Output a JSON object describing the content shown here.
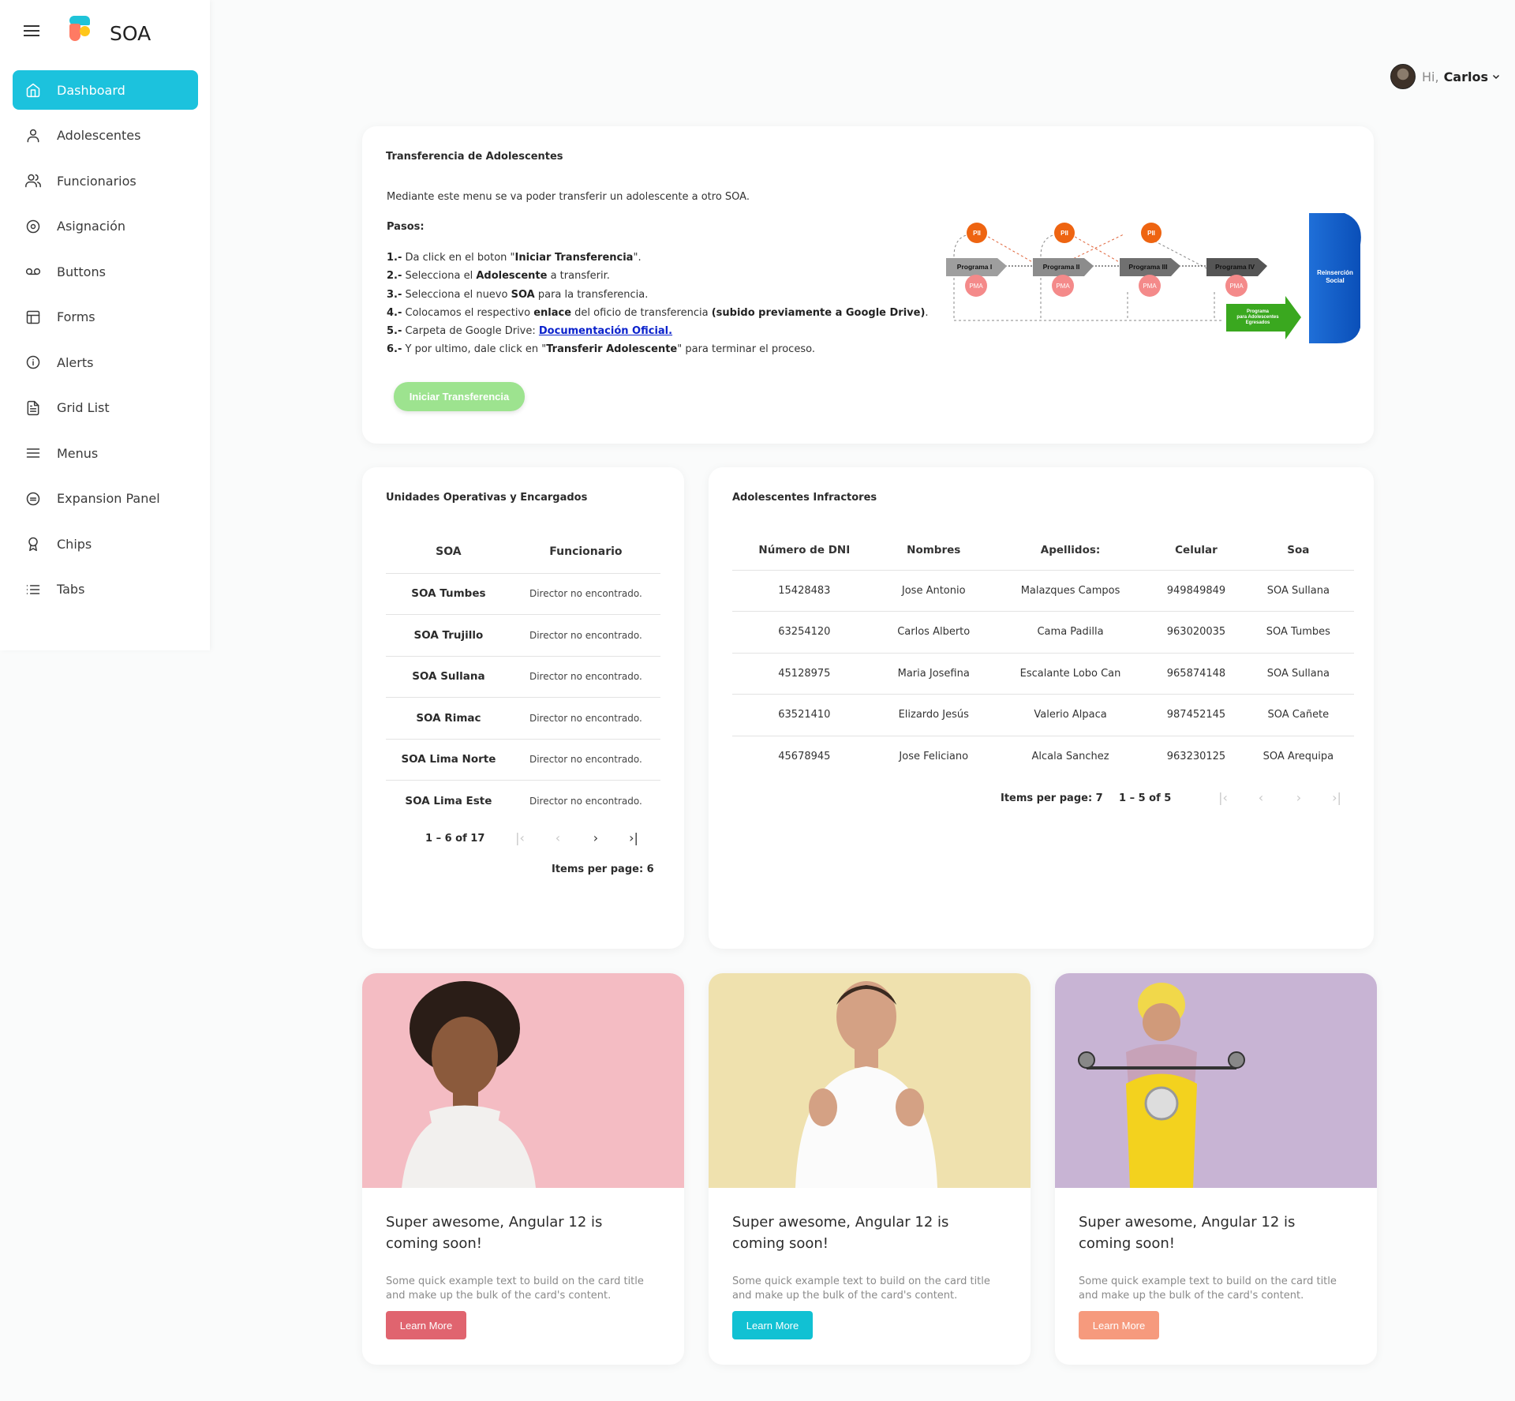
{
  "app": {
    "brand": "SOA"
  },
  "user": {
    "greeting": "Hi,",
    "name": "Carlos"
  },
  "sidebar": {
    "items": [
      {
        "label": "Dashboard",
        "icon": "home-icon",
        "active": true
      },
      {
        "label": "Adolescentes",
        "icon": "user-icon"
      },
      {
        "label": "Funcionarios",
        "icon": "users-icon"
      },
      {
        "label": "Asignación",
        "icon": "target-icon"
      },
      {
        "label": "Buttons",
        "icon": "voicemail-icon"
      },
      {
        "label": "Forms",
        "icon": "layout-icon"
      },
      {
        "label": "Alerts",
        "icon": "info-icon"
      },
      {
        "label": "Grid List",
        "icon": "file-text-icon"
      },
      {
        "label": "Menus",
        "icon": "menu-icon"
      },
      {
        "label": "Expansion Panel",
        "icon": "minus-circle-icon"
      },
      {
        "label": "Chips",
        "icon": "award-icon"
      },
      {
        "label": "Tabs",
        "icon": "list-icon"
      }
    ]
  },
  "transfer": {
    "title": "Transferencia de Adolescentes",
    "intro": "Mediante este menu se va poder transferir un adolescente a otro SOA.",
    "steps_heading": "Pasos:",
    "button": "Iniciar Transferencia",
    "link_text": "Documentación Oficial.",
    "diagram": {
      "programs": [
        "Programa I",
        "Programa II",
        "Programa III",
        "Programa IV"
      ],
      "pii": "PII",
      "pma": "PMA",
      "egresados": [
        "Programa",
        "para Adolescentes",
        "Egresados"
      ],
      "reinsercion": [
        "Reinserción",
        "Social"
      ]
    }
  },
  "units": {
    "title": "Unidades Operativas y Encargados",
    "headers": [
      "SOA",
      "Funcionario"
    ],
    "rows": [
      {
        "soa": "SOA Tumbes",
        "funcionario": "Director no encontrado."
      },
      {
        "soa": "SOA Trujillo",
        "funcionario": "Director no encontrado."
      },
      {
        "soa": "SOA Sullana",
        "funcionario": "Director no encontrado."
      },
      {
        "soa": "SOA Rimac",
        "funcionario": "Director no encontrado."
      },
      {
        "soa": "SOA Lima Norte",
        "funcionario": "Director no encontrado."
      },
      {
        "soa": "SOA Lima Este",
        "funcionario": "Director no encontrado."
      }
    ],
    "range": "1 – 6 of 17",
    "items_per_page": "Items per page: 6"
  },
  "infractores": {
    "title": "Adolescentes Infractores",
    "headers": [
      "Número de DNI",
      "Nombres",
      "Apellidos:",
      "Celular",
      "Soa"
    ],
    "rows": [
      [
        "15428483",
        "Jose Antonio",
        "Malazques Campos",
        "949849849",
        "SOA Sullana"
      ],
      [
        "63254120",
        "Carlos Alberto",
        "Cama Padilla",
        "963020035",
        "SOA Tumbes"
      ],
      [
        "45128975",
        "Maria Josefina",
        "Escalante Lobo Can",
        "965874148",
        "SOA Sullana"
      ],
      [
        "63521410",
        "Elizardo Jesús",
        "Valerio Alpaca",
        "987452145",
        "SOA Cañete"
      ],
      [
        "45678945",
        "Jose Feliciano",
        "Alcala Sanchez",
        "963230125",
        "SOA Arequipa"
      ]
    ],
    "items_per_page": "Items per page: 7",
    "range": "1 – 5 of 5"
  },
  "promo_cards": [
    {
      "title": "Super awesome, Angular 12 is coming soon!",
      "text": "Some quick example text to build on the card title and make up the bulk of the card's content.",
      "button": "Learn More",
      "button_color": "#e0646f",
      "bg_color": "#f4bcc3"
    },
    {
      "title": "Super awesome, Angular 12 is coming soon!",
      "text": "Some quick example text to build on the card title and make up the bulk of the card's content.",
      "button": "Learn More",
      "button_color": "#11c1d3",
      "bg_color": "#efe1ae"
    },
    {
      "title": "Super awesome, Angular 12 is coming soon!",
      "text": "Some quick example text to build on the card title and make up the bulk of the card's content.",
      "button": "Learn More",
      "button_color": "#f69a7d",
      "bg_color": "#c8b4d4"
    }
  ],
  "colors": {
    "accent": "#1cc2dd",
    "transfer_button": "#9de38f",
    "link": "#0b22cc"
  }
}
